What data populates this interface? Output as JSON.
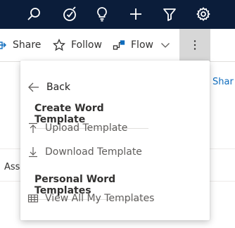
{
  "topbar": {
    "icons": [
      "search-icon",
      "lightbulb-check-icon",
      "lightbulb-icon",
      "plus-icon",
      "filter-icon",
      "gear-icon"
    ]
  },
  "command_bar": {
    "share_label": "Share",
    "follow_label": "Follow",
    "flow_label": "Flow",
    "more_label": "⋮"
  },
  "background": {
    "share_text": "Shar",
    "ass_text": "Ass"
  },
  "menu": {
    "back_label": "Back",
    "section1_title": "Create Word Template",
    "upload_label": "Upload Template",
    "download_label": "Download Template",
    "section2_title": "Personal Word Templates",
    "view_all_label": "View All My Templates"
  },
  "colors": {
    "topbar_bg": "#0b1d3a",
    "link_blue": "#0f6cbd",
    "more_button_bg": "#d7d7d7"
  }
}
